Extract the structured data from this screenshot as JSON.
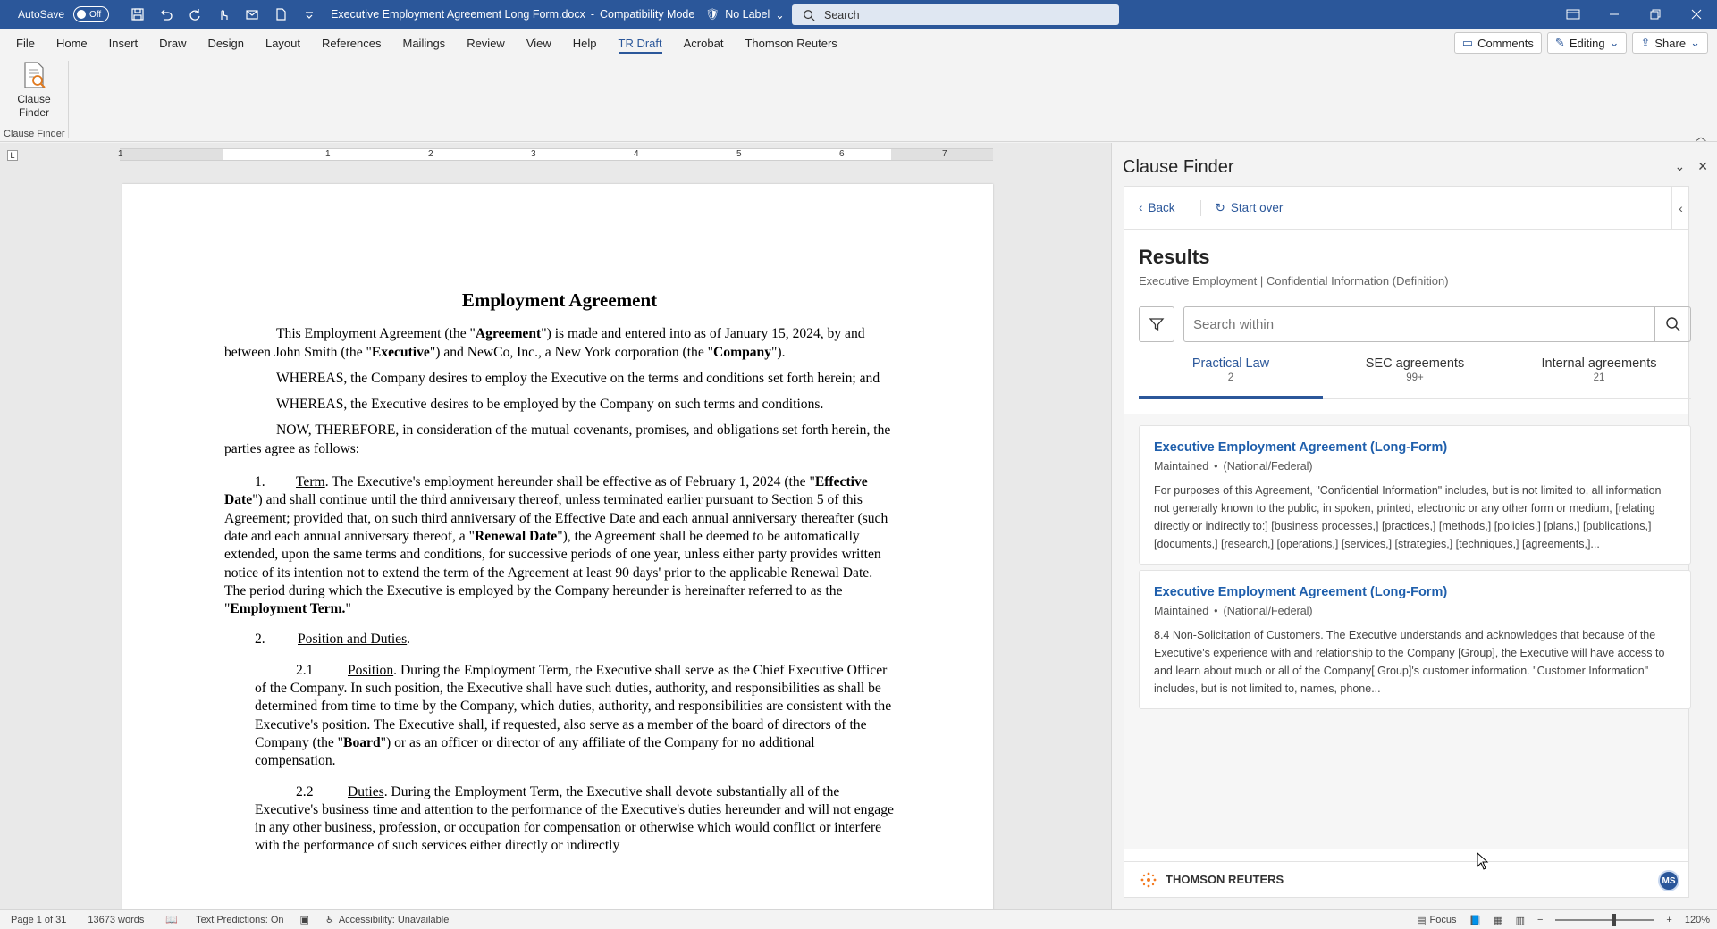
{
  "titlebar": {
    "autosave_label": "AutoSave",
    "autosave_state": "Off",
    "doc_title": "Executive Employment Agreement Long Form.docx",
    "separator": " - ",
    "mode": "Compatibility Mode",
    "sensitivity_label": "No Label",
    "search_placeholder": "Search"
  },
  "ribbon_tabs": [
    "File",
    "Home",
    "Insert",
    "Draw",
    "Design",
    "Layout",
    "References",
    "Mailings",
    "Review",
    "View",
    "Help",
    "TR Draft",
    "Acrobat",
    "Thomson Reuters"
  ],
  "active_tab": "TR Draft",
  "ribbon_right": {
    "comments": "Comments",
    "editing": "Editing",
    "share": "Share"
  },
  "ribbon": {
    "clause_finder_line1": "Clause",
    "clause_finder_line2": "Finder",
    "group_label": "Clause Finder"
  },
  "ruler": {
    "numbers": [
      "1",
      "1",
      "2",
      "3",
      "4",
      "5",
      "6",
      "7"
    ],
    "corner": "L"
  },
  "document": {
    "heading": "Employment Agreement",
    "p1_a": "This Employment Agreement (the \"",
    "p1_b": "Agreement",
    "p1_c": "\") is made and entered into as of January 15, 2024, by and between John Smith (the \"",
    "p1_d": "Executive",
    "p1_e": "\") and NewCo, Inc., a New York corporation (the \"",
    "p1_f": "Company",
    "p1_g": "\").",
    "p2": "WHEREAS, the Company desires to employ the Executive on the terms and conditions set forth herein; and",
    "p3": "WHEREAS, the Executive desires to be employed by the Company on such terms and conditions.",
    "p4": "NOW, THEREFORE, in consideration of the mutual covenants, promises, and obligations set forth herein, the parties agree as follows:",
    "s1_num": "1.",
    "s1_title": "Term",
    "s1_a": ". The Executive's employment hereunder shall be effective as of February 1, 2024 (the \"",
    "s1_b": "Effective Date",
    "s1_c": "\") and shall continue until the third anniversary thereof, unless terminated earlier pursuant to Section 5 of this Agreement; provided that, on such third anniversary of the Effective Date and each annual anniversary thereafter (such date and each annual anniversary thereof, a \"",
    "s1_d": "Renewal Date",
    "s1_e": "\"), the Agreement shall be deemed to be automatically extended, upon the same terms and conditions, for successive periods of one year, unless either party provides written notice of its intention not to extend the term of the Agreement at least 90 days' prior to the applicable Renewal Date. The period during which the Executive is employed by the Company hereunder is hereinafter referred to as the \"",
    "s1_f": "Employment Term.",
    "s1_g": "\"",
    "s2_num": "2.",
    "s2_title": "Position and Duties",
    "s2_dot": ".",
    "s21_num": "2.1",
    "s21_title": "Position",
    "s21_a": ". During the Employment Term, the Executive shall serve as the Chief Executive Officer of the Company. In such position, the Executive shall have such duties, authority, and responsibilities as shall be determined from time to time by the Company, which duties, authority, and responsibilities are consistent with the Executive's position. The Executive shall, if requested, also serve as a member of the board of directors of the Company (the \"",
    "s21_b": "Board",
    "s21_c": "\") or as an officer or director of any affiliate of the Company for no additional compensation.",
    "s22_num": "2.2",
    "s22_title": "Duties",
    "s22_a": ". During the Employment Term, the Executive shall devote substantially all of the Executive's business time and attention to the performance of the Executive's duties hereunder and will not engage in any other business, profession, or occupation for compensation or otherwise which would conflict or interfere with the performance of such services either directly or indirectly"
  },
  "pane": {
    "title": "Clause Finder",
    "back": "Back",
    "start_over": "Start over",
    "results_heading": "Results",
    "results_sub": "Executive Employment | Confidential Information (Definition)",
    "search_placeholder": "Search within",
    "tabs": [
      {
        "label": "Practical Law",
        "count": "2"
      },
      {
        "label": "SEC agreements",
        "count": "99+"
      },
      {
        "label": "Internal agreements",
        "count": "21"
      }
    ],
    "cards": [
      {
        "title": "Executive Employment Agreement (Long-Form)",
        "status": "Maintained",
        "dot": "•",
        "jurisdiction": "(National/Federal)",
        "text": "For purposes of this Agreement, \"Confidential Information\" includes, but is not limited to, all information not generally known to the public, in spoken, printed, electronic or any other form or medium, [relating directly or indirectly to:] [business processes,] [practices,] [methods,] [policies,] [plans,] [publications,] [documents,] [research,] [operations,] [services,] [strategies,] [techniques,] [agreements,]..."
      },
      {
        "title": "Executive Employment Agreement (Long-Form)",
        "status": "Maintained",
        "dot": "•",
        "jurisdiction": "(National/Federal)",
        "text": "8.4 Non-Solicitation of Customers. The Executive understands and acknowledges that because of the Executive's experience with and relationship to the Company [Group], the Executive will have access to and learn about much or all of the Company[ Group]'s customer information. \"Customer Information\" includes, but is not limited to, names, phone..."
      }
    ],
    "footer_brand": "THOMSON REUTERS",
    "avatar_initials": "MS"
  },
  "status": {
    "page": "Page 1 of 31",
    "words": "13673 words",
    "text_predictions": "Text Predictions: On",
    "accessibility": "Accessibility: Unavailable",
    "focus": "Focus",
    "zoom": "120%",
    "zoom_minus": "−",
    "zoom_plus": "+"
  },
  "colors": {
    "brand": "#2b579a",
    "link": "#1f5fac"
  }
}
